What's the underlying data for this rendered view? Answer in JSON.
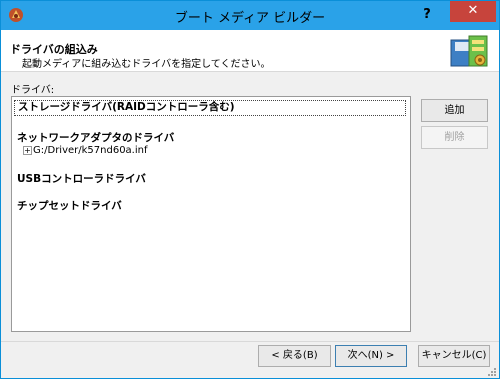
{
  "window": {
    "title": "ブート メディア ビルダー",
    "help_label": "?",
    "close_label": "✕"
  },
  "header": {
    "title": "ドライバの組込み",
    "subtitle": "起動メディアに組み込むドライバを指定してください。"
  },
  "drivers": {
    "section_label": "ドライバ:",
    "categories": [
      {
        "label": "ストレージドライバ(RAIDコントローラ含む)"
      },
      {
        "label": "ネットワークアダプタのドライバ",
        "items": [
          {
            "expander": "+",
            "path": "G:/Driver/k57nd60a.inf"
          }
        ]
      },
      {
        "label": "USBコントローラドライバ"
      },
      {
        "label": "チップセットドライバ"
      }
    ]
  },
  "side_buttons": {
    "add_label": "追加",
    "remove_label": "削除"
  },
  "footer": {
    "back_label": "< 戻る(B)",
    "next_label": "次へ(N) >",
    "cancel_label": "キャンセル(C)"
  }
}
